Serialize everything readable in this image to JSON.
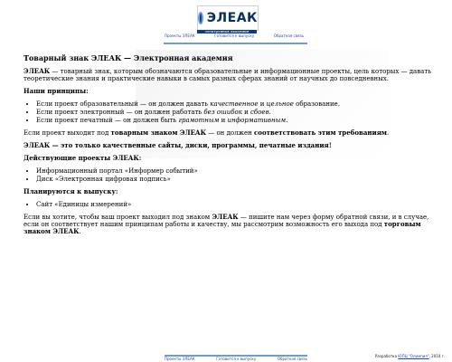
{
  "logo": {
    "text": "ЭЛЕАК",
    "subtitle": "электронная академия"
  },
  "nav": {
    "items": [
      "Проекты ЭЛЕАК",
      "Готовится к выпуску",
      "Обратная связь"
    ]
  },
  "content": {
    "title": "Товарный знак ЭЛЕАК — Электронная академия",
    "intro": {
      "brand": "ЭЛЕАК",
      "rest": " — товарный знак, которым обозначаются образовательные и информационные проекты, цель которых — давать теоретические знания и практические навыки в самых разных сферах знаний от научных до повседневных."
    },
    "principles_heading": "Наши принципы:",
    "principles": [
      {
        "prefix": "Если проект образовательный — он должен давать ",
        "emph": "качественное",
        "middle": " и ",
        "emph2": "цельное",
        "suffix": " образование."
      },
      {
        "prefix": "Если проект электронный — он должен работать ",
        "emph": "без ошибок",
        "middle": " и ",
        "emph2": "сбоев",
        "suffix": "."
      },
      {
        "prefix": "Если проект печатный — он должен быть ",
        "emph": "грамотным",
        "middle": " и ",
        "emph2": "информативным",
        "suffix": "."
      }
    ],
    "rule": {
      "prefix": "Если проект выходит под ",
      "strong1": "товарным знаком ЭЛЕАК",
      "middle": " — он должен ",
      "strong2": "соответствовать этим требованиям",
      "suffix": "."
    },
    "quality": "ЭЛЕАК — это только качественные сайты, диски, программы, печатные издания!",
    "current_heading": "Действующие проекты ЭЛЕАК:",
    "current_projects": [
      "Информационный портал «Информер событий»",
      "Диск «Электронная цифровая подпись»"
    ],
    "planned_heading": "Планируются к выпуску:",
    "planned_projects": [
      "Сайт «Единицы измерений»"
    ],
    "final": {
      "prefix": "Если вы хотите, чтобы ваш проект выходил под знаком ",
      "brand": "ЭЛЕАК",
      "middle": " — пишите нам через форму обратной связи, и в случае, если он соответствует нашим принципам работы и качеству, мы рассмотрим возможность его выхода под ",
      "strong": "торговым знаком ЭЛЕАК",
      "suffix": "."
    }
  },
  "footer": {
    "items": [
      "Проекты ЭЛЕАК",
      "Готовится к выпуску",
      "Обратная связь"
    ],
    "developer_prefix": "Разработка ",
    "developer_link": "ЮПЦ \"Олимпия\"",
    "developer_suffix": ", 2010 г."
  },
  "colors": {
    "nav": "#2d4a86",
    "nav_line": "#6f9bd3",
    "logo_blue": "#0b3d91"
  }
}
